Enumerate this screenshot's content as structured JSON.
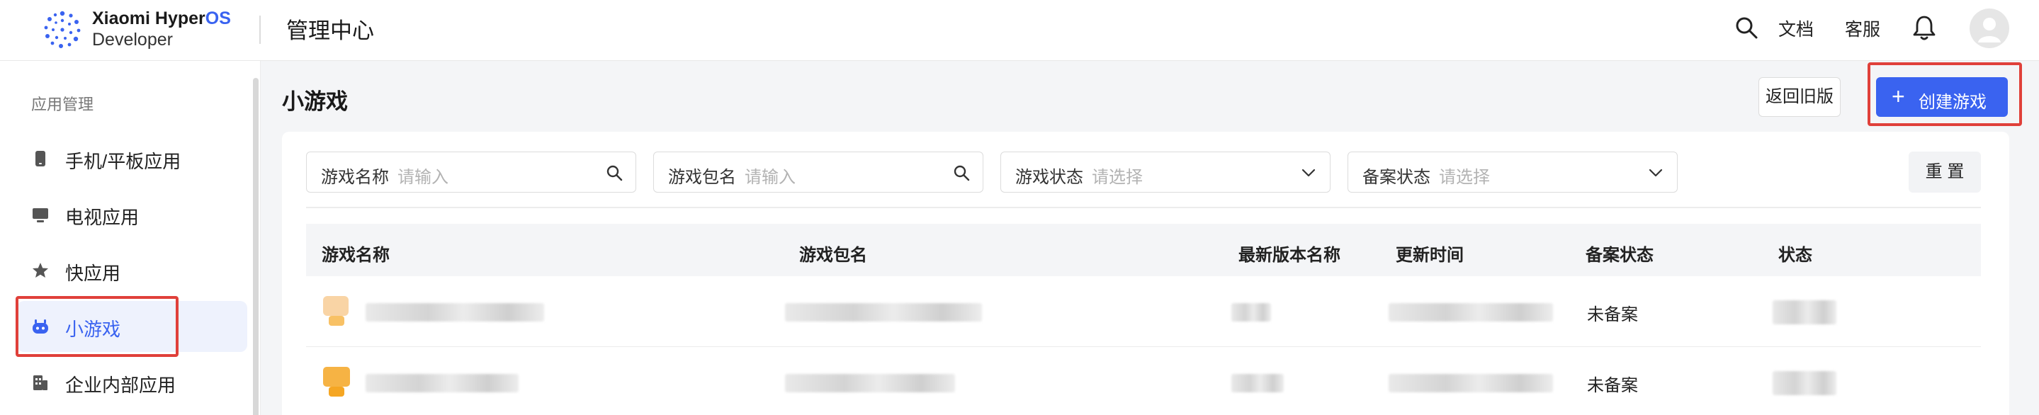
{
  "header": {
    "brand_line1": "Xiaomi Hyper",
    "brand_line1_accent": "OS",
    "brand_line2": "Developer",
    "title": "管理中心",
    "links": {
      "docs": "文档",
      "support": "客服"
    },
    "icons": [
      "search-icon",
      "bell-icon",
      "user-avatar-icon"
    ]
  },
  "sidebar": {
    "group_label": "应用管理",
    "items": [
      {
        "label": "手机/平板应用",
        "icon": "phone-icon",
        "active": false
      },
      {
        "label": "电视应用",
        "icon": "tv-icon",
        "active": false
      },
      {
        "label": "快应用",
        "icon": "star-icon",
        "active": false
      },
      {
        "label": "小游戏",
        "icon": "gamepad-icon",
        "active": true
      },
      {
        "label": "企业内部应用",
        "icon": "building-icon",
        "active": false
      }
    ]
  },
  "main": {
    "title": "小游戏",
    "back_label": "返回旧版",
    "create_label": "创建游戏",
    "filters": {
      "name_label": "游戏名称",
      "name_placeholder": "请输入",
      "package_label": "游戏包名",
      "package_placeholder": "请输入",
      "status_label": "游戏状态",
      "status_placeholder": "请选择",
      "filing_label": "备案状态",
      "filing_placeholder": "请选择"
    },
    "reset_label": "重 置",
    "table": {
      "columns": [
        "游戏名称",
        "游戏包名",
        "最新版本名称",
        "更新时间",
        "备案状态",
        "状态"
      ],
      "rows": [
        {
          "filing_status": "未备案"
        },
        {
          "filing_status": "未备案"
        }
      ]
    }
  },
  "colors": {
    "accent": "#3a63f0",
    "highlight_box": "#e0403a",
    "icon_orange": "#f5a623"
  }
}
